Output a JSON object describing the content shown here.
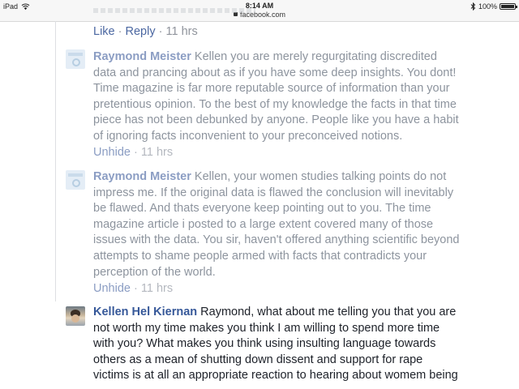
{
  "status_bar": {
    "device": "iPad",
    "time": "8:14 AM",
    "url": "facebook.com",
    "battery_text": "100%",
    "battery_level": 1.0
  },
  "top_actions": {
    "like": "Like",
    "sep": "·",
    "reply": "Reply",
    "time_sep": "·",
    "time": "11 hrs"
  },
  "comments": [
    {
      "author": "Raymond Meister",
      "lines": [
        "Kellen you are merely regurgitating discredited",
        "data and prancing about as if you have some deep insights. You dont!",
        "Time magazine is far more reputable source of information than your",
        "pretentious opinion. To the best of my knowledge the facts in that time",
        "piece has not been debunked by anyone. People like you have a habit",
        "of ignoring facts inconvenient to your preconceived notions."
      ],
      "action": "Unhide",
      "sep": "·",
      "time": "11 hrs"
    },
    {
      "author": "Raymond Meister",
      "lines": [
        "Kellen, your women studies talking points do not",
        "impress me. If the original data is flawed the conclusion will inevitably",
        "be flawed. And thats everyone keep pointing out to you. The time",
        "magazine article i posted to a large extent covered many of those",
        "issues with the data. You sir, haven't offered anything scientific beyond",
        "attempts to shame people armed with facts that contradicts your",
        "perception of the world."
      ],
      "action": "Unhide",
      "sep": "·",
      "time": "11 hrs"
    },
    {
      "author": "Kellen Hel Kiernan",
      "lines": [
        "Raymond, what about me telling you that you are",
        "not worth my time makes you think I am willing to spend more time",
        "with you? What makes you think using insulting language towards",
        "others as a mean of shutting down dissent and support for rape",
        "victims is at all an appropriate reaction to hearing about womem being"
      ]
    }
  ]
}
